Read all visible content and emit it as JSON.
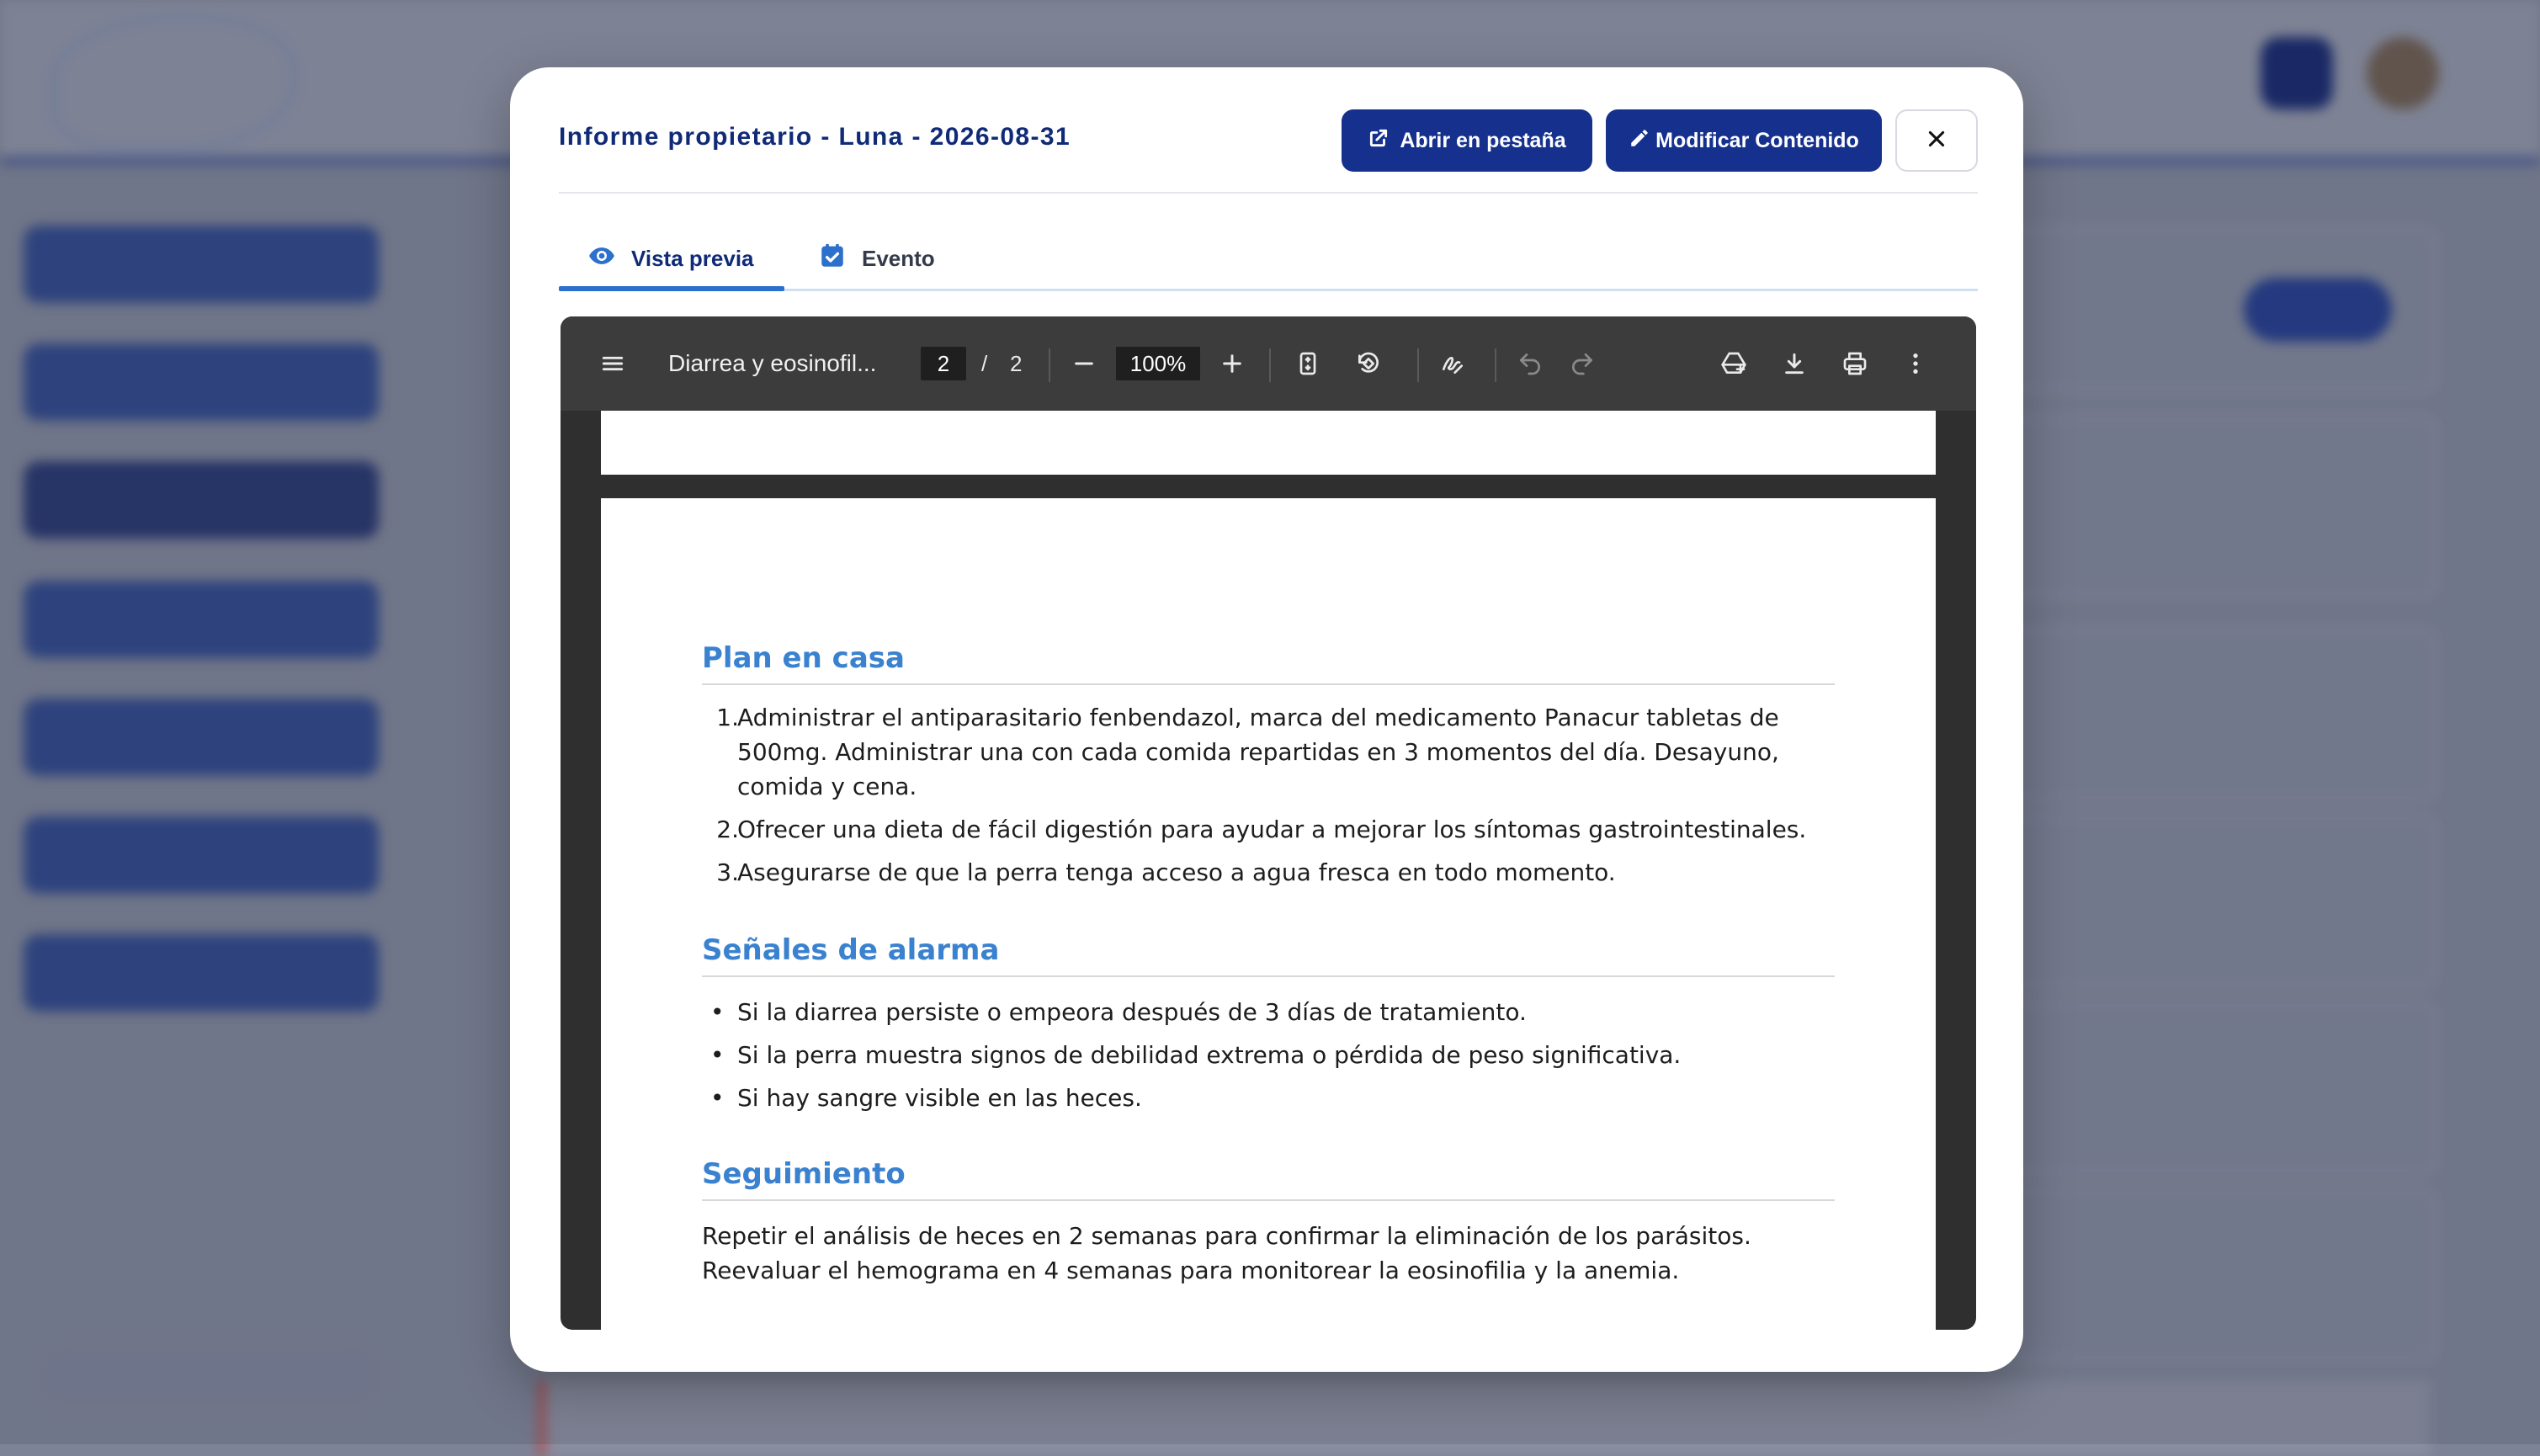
{
  "modal": {
    "title": "Informe propietario - Luna - 2026-08-31",
    "open_tab_label": "Abrir en pestaña",
    "edit_label": "Modificar Contenido",
    "tabs": [
      {
        "label": "Vista previa",
        "active": true,
        "icon": "eye-icon"
      },
      {
        "label": "Evento",
        "active": false,
        "icon": "calendar-check-icon"
      }
    ]
  },
  "pdf_viewer": {
    "document_title": "Diarrea y eosinofil...",
    "current_page": "2",
    "separator": "/",
    "total_pages": "2",
    "zoom": "100%"
  },
  "document": {
    "plan_heading": "Plan en casa",
    "plan_items": [
      {
        "num": "1.",
        "lines": [
          "Administrar el antiparasitario fenbendazol, marca del medicamento Panacur tabletas de",
          "500mg. Administrar una con cada comida repartidas en 3 momentos del día. Desayuno,",
          "comida y cena."
        ]
      },
      {
        "num": "2.",
        "lines": [
          "Ofrecer una dieta de fácil digestión para ayudar a mejorar los síntomas gastrointestinales."
        ]
      },
      {
        "num": "3.",
        "lines": [
          "Asegurarse de que la perra tenga acceso a agua fresca en todo momento."
        ]
      }
    ],
    "alarm_heading": "Señales de alarma",
    "alarm_items": [
      "Si la diarrea persiste o empeora después de 3 días de tratamiento.",
      "Si la perra muestra signos de debilidad extrema o pérdida de peso significativa.",
      "Si hay sangre visible en las heces."
    ],
    "followup_heading": "Seguimiento",
    "followup_lines": [
      "Repetir el análisis de heces en 2 semanas para confirmar la eliminación de los parásitos.",
      "Reevaluar el hemograma en 4 semanas para monitorear la eosinofilia y la anemia."
    ]
  },
  "colors": {
    "primary": "#16318d",
    "heading_blue": "#3a82cf",
    "viewer_toolbar": "#3c3c3c"
  }
}
